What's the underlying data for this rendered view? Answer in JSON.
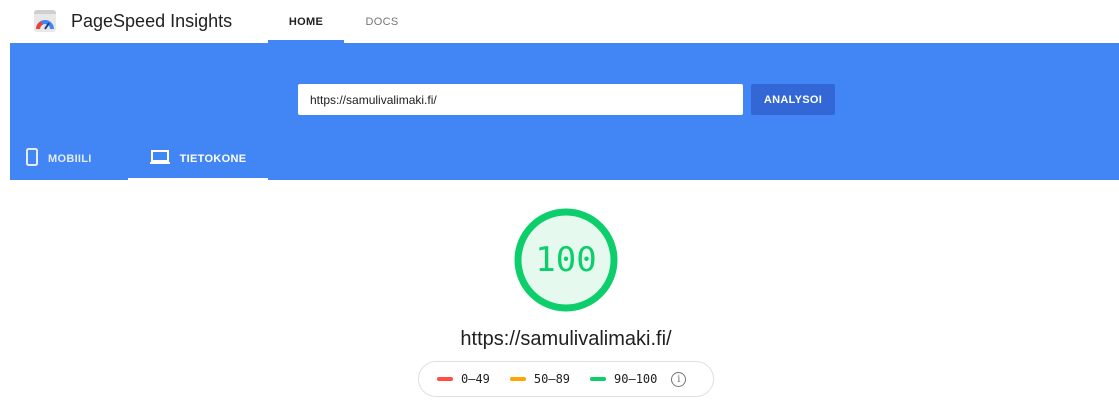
{
  "app": {
    "title": "PageSpeed Insights"
  },
  "nav": {
    "tabs": [
      {
        "label": "HOME"
      },
      {
        "label": "DOCS"
      }
    ]
  },
  "search": {
    "url_value": "https://samulivalimaki.fi/",
    "analyze_label": "ANALYSOI"
  },
  "device_tabs": [
    {
      "label": "MOBIILI",
      "icon": "phone-icon"
    },
    {
      "label": "TIETOKONE",
      "icon": "laptop-icon",
      "selected": true
    }
  ],
  "result": {
    "score": "100",
    "url": "https://samulivalimaki.fi/"
  },
  "legend": {
    "items": [
      {
        "label": "0–49",
        "color": "#ff4e42"
      },
      {
        "label": "50–89",
        "color": "#ffa400"
      },
      {
        "label": "90–100",
        "color": "#0cce6b"
      }
    ],
    "info_glyph": "i"
  },
  "colors": {
    "brand_blue": "#4285f4",
    "button_blue": "#3367d6",
    "pass_green": "#0cce6b"
  }
}
